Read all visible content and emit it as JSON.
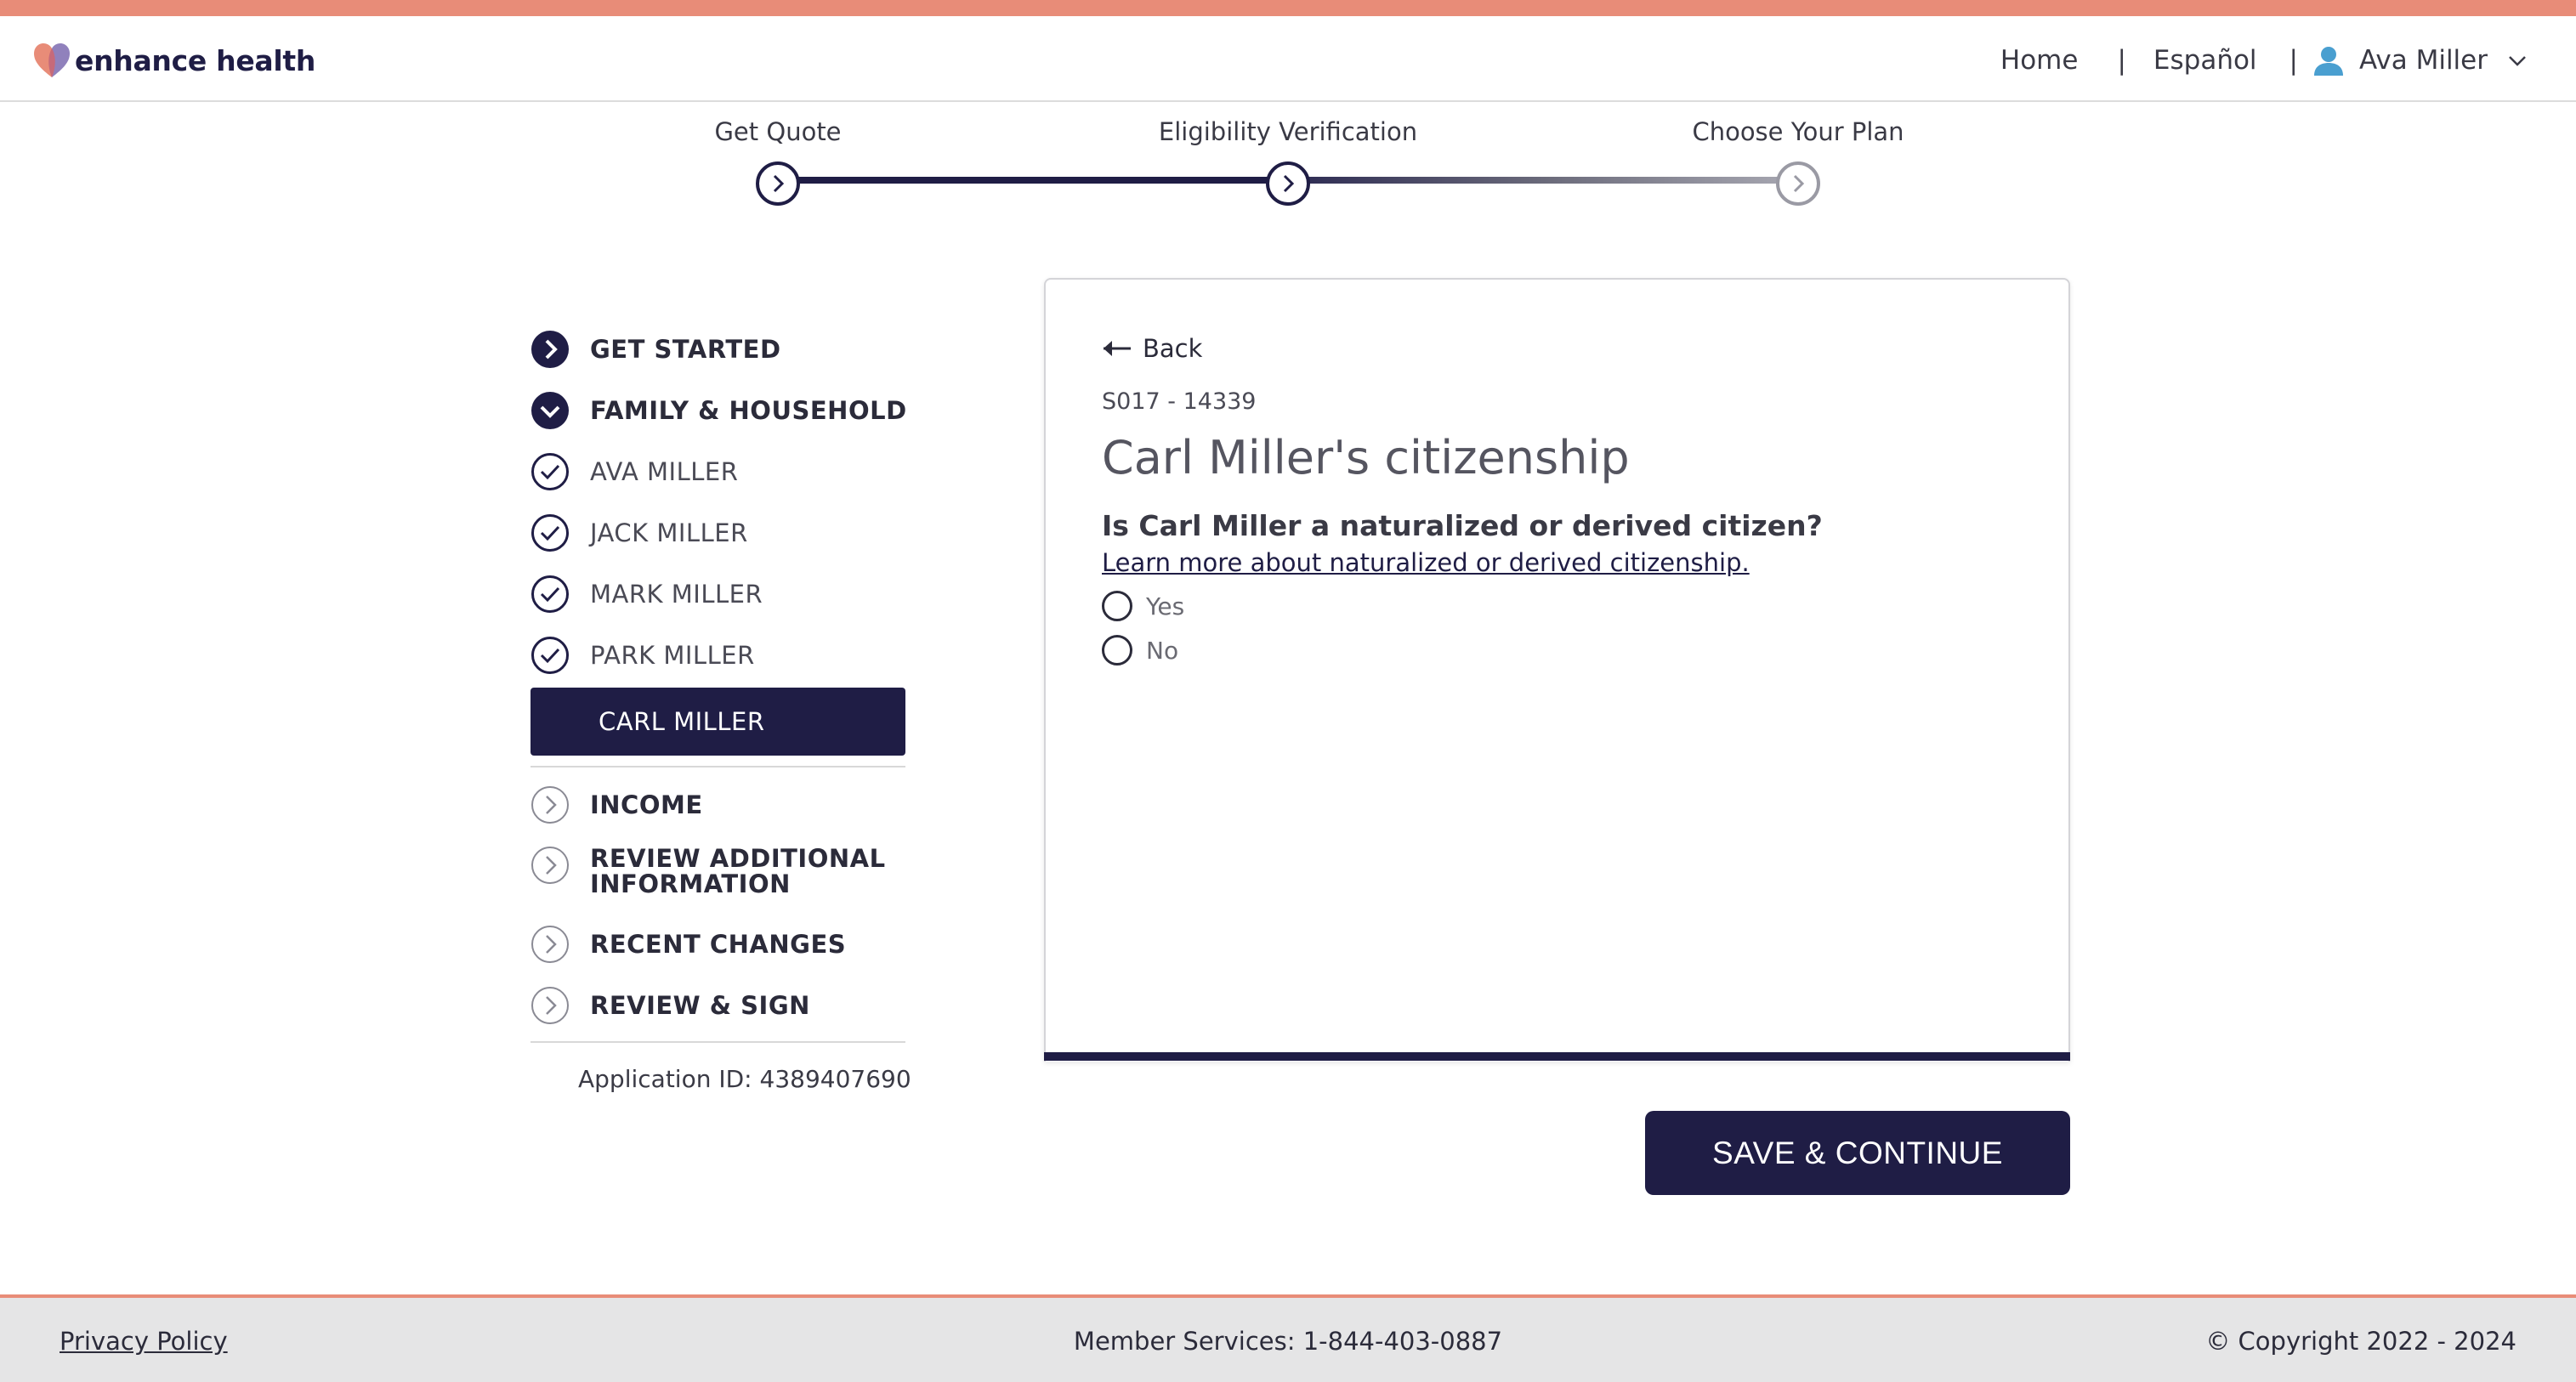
{
  "header": {
    "brand": "enhance health",
    "nav": {
      "home": "Home",
      "language": "Español",
      "user_name": "Ava Miller",
      "separator": "|"
    }
  },
  "stepper": {
    "steps": [
      {
        "label": "Get Quote",
        "state": "complete"
      },
      {
        "label": "Eligibility Verification",
        "state": "current"
      },
      {
        "label": "Choose Your Plan",
        "state": "upcoming"
      }
    ]
  },
  "sidebar": {
    "items": [
      {
        "label": "GET STARTED",
        "icon": "chevron-right-filled-icon"
      },
      {
        "label": "FAMILY & HOUSEHOLD",
        "icon": "chevron-down-filled-icon"
      },
      {
        "label": "AVA MILLER",
        "icon": "check-circle-icon"
      },
      {
        "label": "JACK MILLER",
        "icon": "check-circle-icon"
      },
      {
        "label": "MARK MILLER",
        "icon": "check-circle-icon"
      },
      {
        "label": "PARK MILLER",
        "icon": "check-circle-icon"
      }
    ],
    "active": "CARL MILLER",
    "sections": [
      {
        "label": "INCOME",
        "icon": "chevron-right-outline-icon"
      },
      {
        "label": "REVIEW ADDITIONAL INFORMATION",
        "line1": "REVIEW ADDITIONAL",
        "line2": "INFORMATION",
        "icon": "chevron-right-outline-icon"
      },
      {
        "label": "RECENT CHANGES",
        "icon": "chevron-right-outline-icon"
      },
      {
        "label": "REVIEW & SIGN",
        "icon": "chevron-right-outline-icon"
      }
    ],
    "application_id": "Application ID: 4389407690"
  },
  "card": {
    "back": "Back",
    "code": "S017 - 14339",
    "title": "Carl Miller's citizenship",
    "question": "Is Carl Miller a naturalized or derived citizen?",
    "learn_link": "Learn more about naturalized or derived citizenship.",
    "options": [
      "Yes",
      "No"
    ],
    "selected": null
  },
  "actions": {
    "save": "SAVE & CONTINUE"
  },
  "footer": {
    "privacy": "Privacy Policy",
    "member_services": "Member Services: 1-844-403-0887",
    "copyright": "© Copyright 2022 - 2024"
  },
  "colors": {
    "navy": "#1f1d45",
    "coral": "#e88c78",
    "footer_bg": "#e5e5e6",
    "gray": "#8a8a94"
  }
}
